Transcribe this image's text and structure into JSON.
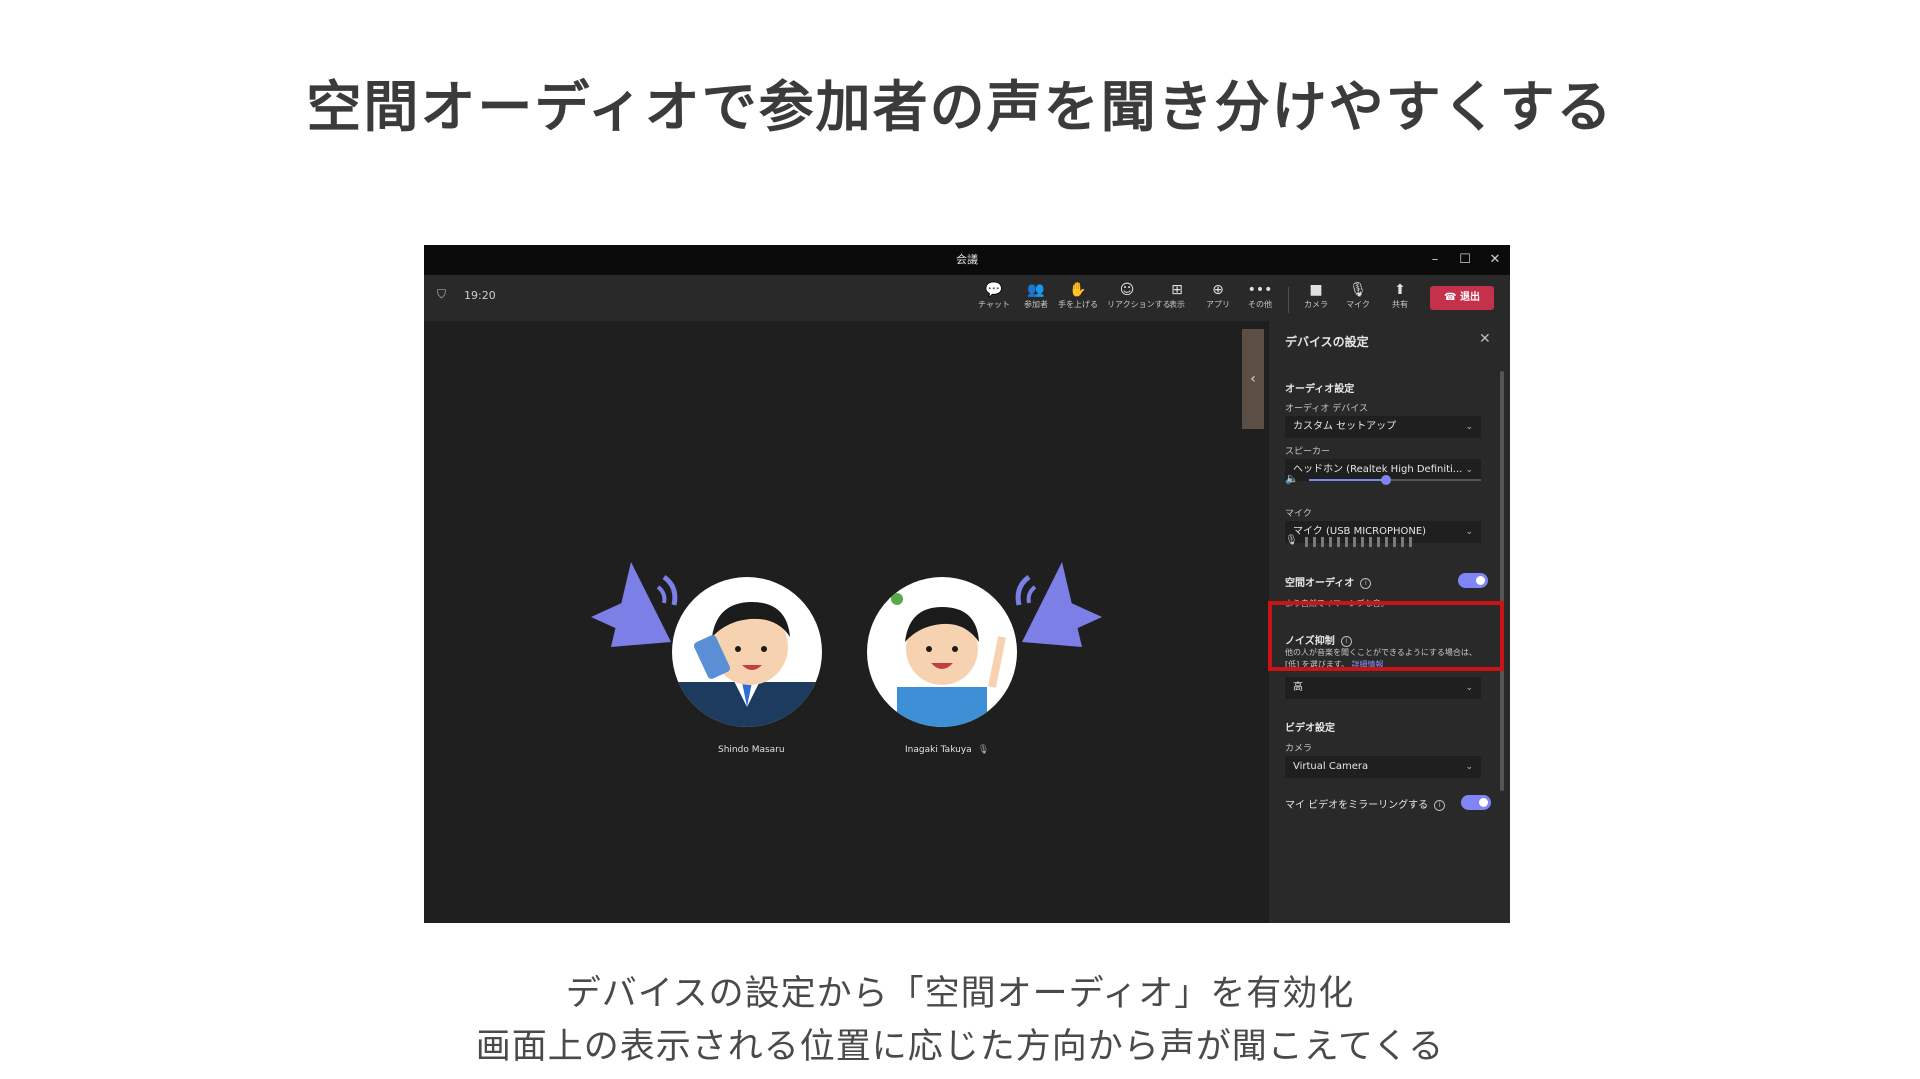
{
  "slide": {
    "title": "空間オーディオで参加者の声を聞き分けやすくする",
    "caption_line1": "デバイスの設定から「空間オーディオ」を有効化",
    "caption_line2": "画面上の表示される位置に応じた方向から声が聞こえてくる"
  },
  "window": {
    "title": "会議",
    "minimize": "–",
    "maximize": "☐",
    "close": "✕"
  },
  "meeting": {
    "time": "19:20",
    "toolbar": [
      {
        "icon": "chat-icon",
        "glyph": "💬",
        "label": "チャット"
      },
      {
        "icon": "people-icon",
        "glyph": "👥",
        "label": "参加者"
      },
      {
        "icon": "raise-hand-icon",
        "glyph": "✋",
        "label": "手を上げる"
      },
      {
        "icon": "reactions-icon",
        "glyph": "☺",
        "label": "リアクションする"
      },
      {
        "icon": "view-icon",
        "glyph": "⊞",
        "label": "表示"
      },
      {
        "icon": "apps-icon",
        "glyph": "⊕",
        "label": "アプリ"
      },
      {
        "icon": "more-icon",
        "glyph": "•••",
        "label": "その他"
      },
      {
        "icon": "camera-off-icon",
        "glyph": "■",
        "label": "カメラ"
      },
      {
        "icon": "mic-off-icon",
        "glyph": "🎙",
        "label": "マイク"
      },
      {
        "icon": "share-icon",
        "glyph": "⬆",
        "label": "共有"
      }
    ],
    "leave_label": "退出",
    "participants": [
      {
        "name": "Shindo Masaru"
      },
      {
        "name": "Inagaki Takuya"
      }
    ]
  },
  "device_settings": {
    "title": "デバイスの設定",
    "audio_heading": "オーディオ設定",
    "audio_device_label": "オーディオ デバイス",
    "audio_device_value": "カスタム セットアップ",
    "speaker_label": "スピーカー",
    "speaker_value": "ヘッドホン (Realtek High Definiti...",
    "speaker_volume": 0.45,
    "mic_label": "マイク",
    "mic_value": "マイク (USB MICROPHONE)",
    "spatial_audio_label": "空間オーディオ",
    "spatial_audio_on": true,
    "spatial_audio_desc": "より自然でイマーシブな音。",
    "noise_label": "ノイズ抑制",
    "noise_desc": "他の人が音楽を聞くことができるようにする場合は、[低] を選びます。",
    "noise_link": "詳細情報",
    "noise_value": "高",
    "video_heading": "ビデオ設定",
    "camera_label": "カメラ",
    "camera_value": "Virtual Camera",
    "mirror_label": "マイ ビデオをミラーリングする",
    "mirror_on": true
  },
  "colors": {
    "accent": "#7f85f5",
    "leave": "#c4314b",
    "highlight": "#c81414",
    "speaker_icon": "#7b7fe6"
  }
}
